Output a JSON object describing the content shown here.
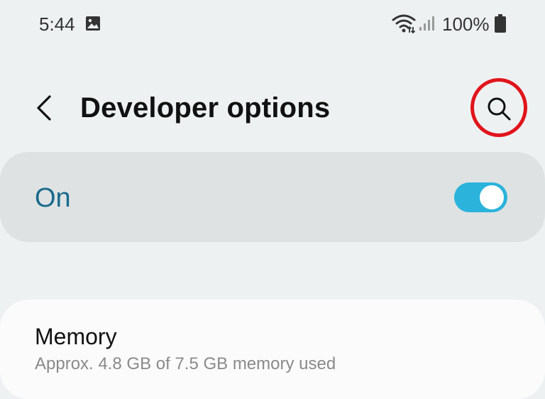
{
  "status_bar": {
    "time": "5:44",
    "notification_icon": "gallery-icon",
    "wifi_icon": "wifi-icon",
    "signal_icon": "signal-icon",
    "battery_percent": "100%",
    "battery_icon": "battery-icon"
  },
  "header": {
    "back_icon": "chevron-left-icon",
    "title": "Developer options",
    "search_icon": "search-icon",
    "highlight_color": "#e0141b"
  },
  "master_switch": {
    "label": "On",
    "state": true,
    "accent_color": "#2bb3dc",
    "label_color": "#1a6a8c"
  },
  "settings": {
    "items": [
      {
        "title": "Memory",
        "summary": "Approx. 4.8 GB of 7.5 GB memory used"
      }
    ]
  }
}
